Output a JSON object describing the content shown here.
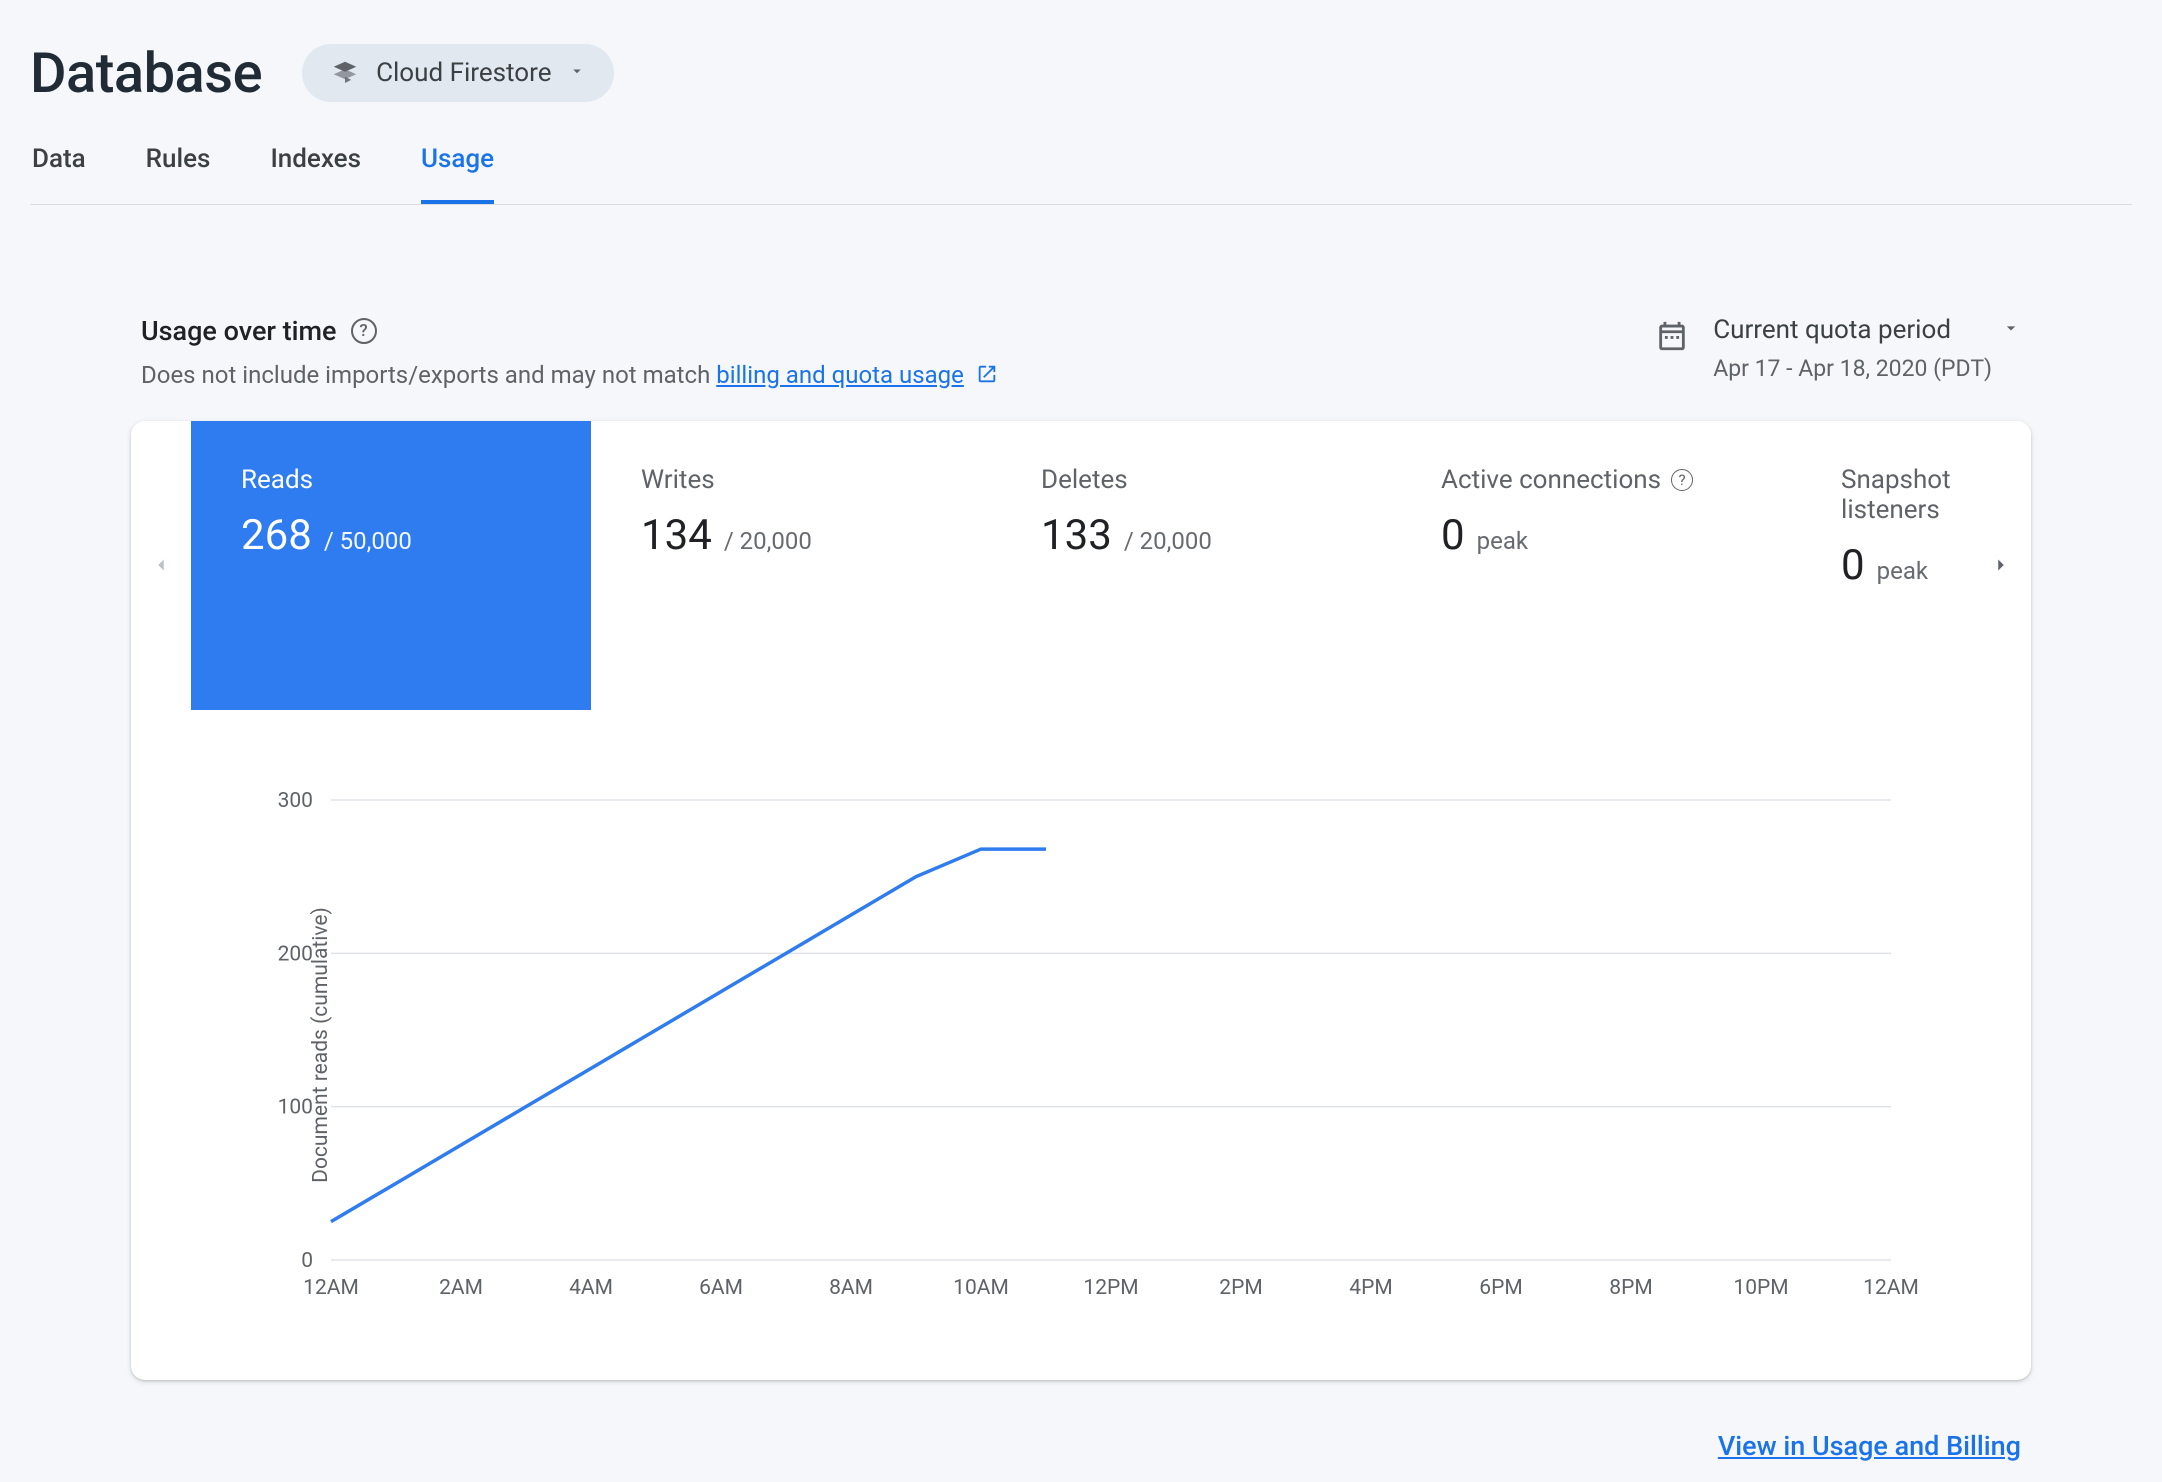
{
  "header": {
    "title": "Database",
    "selector_label": "Cloud Firestore"
  },
  "tabs": [
    {
      "label": "Data",
      "active": false
    },
    {
      "label": "Rules",
      "active": false
    },
    {
      "label": "Indexes",
      "active": false
    },
    {
      "label": "Usage",
      "active": true
    }
  ],
  "usage_header": {
    "title": "Usage over time",
    "subtitle_prefix": "Does not include imports/exports and may not match ",
    "subtitle_link": "billing and quota usage",
    "period_label": "Current quota period",
    "period_range": "Apr 17 - Apr 18, 2020 (PDT)"
  },
  "metrics": [
    {
      "title": "Reads",
      "value": "268",
      "suffix": "/ 50,000",
      "active": true
    },
    {
      "title": "Writes",
      "value": "134",
      "suffix": "/ 20,000",
      "active": false
    },
    {
      "title": "Deletes",
      "value": "133",
      "suffix": "/ 20,000",
      "active": false
    },
    {
      "title": "Active connections",
      "value": "0",
      "suffix": "peak",
      "active": false,
      "help": true
    },
    {
      "title": "Snapshot listeners",
      "value": "0",
      "suffix": "peak",
      "active": false
    }
  ],
  "chart_data": {
    "type": "line",
    "title": "",
    "ylabel": "Document reads (cumulative)",
    "xlabel": "",
    "ylim": [
      0,
      300
    ],
    "yticks": [
      0,
      100,
      200,
      300
    ],
    "x_categories": [
      "12AM",
      "2AM",
      "4AM",
      "6AM",
      "8AM",
      "10AM",
      "12PM",
      "2PM",
      "4PM",
      "6PM",
      "8PM",
      "10PM",
      "12AM"
    ],
    "series": [
      {
        "name": "Reads",
        "x": [
          "12AM",
          "1AM",
          "2AM",
          "3AM",
          "4AM",
          "5AM",
          "6AM",
          "7AM",
          "8AM",
          "9AM",
          "10AM",
          "11AM"
        ],
        "values": [
          25,
          50,
          75,
          100,
          125,
          150,
          175,
          200,
          225,
          250,
          268,
          268
        ]
      }
    ]
  },
  "footer": {
    "link_text": "View in Usage and Billing"
  }
}
